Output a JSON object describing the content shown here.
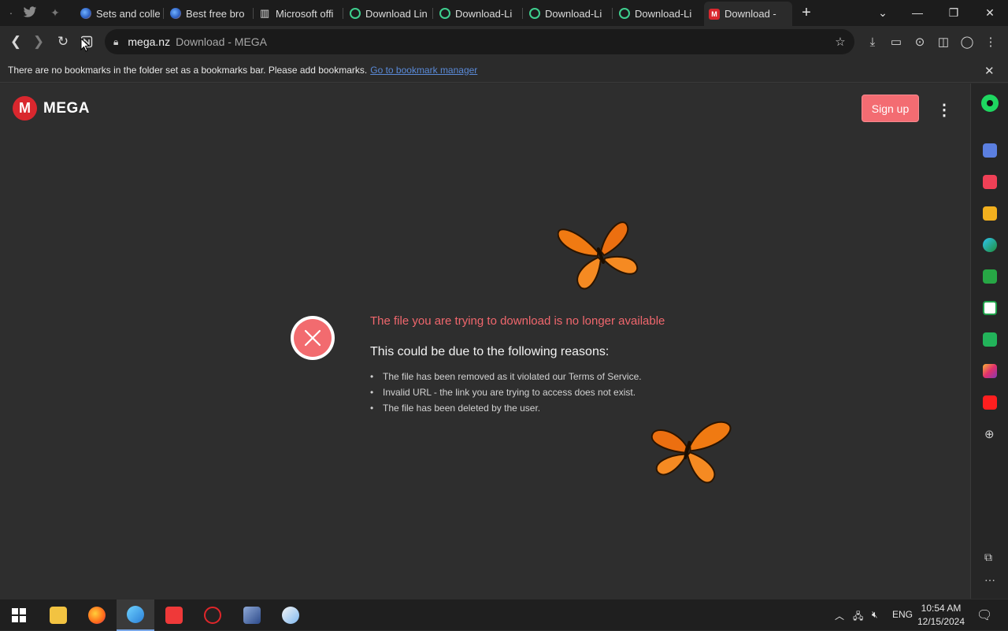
{
  "tabs": [
    {
      "label": "Sets and colle"
    },
    {
      "label": "Best free bro"
    },
    {
      "label": "Microsoft offi"
    },
    {
      "label": "Download Lin"
    },
    {
      "label": "Download-Li"
    },
    {
      "label": "Download-Li"
    },
    {
      "label": "Download-Li"
    },
    {
      "label": "Download - "
    }
  ],
  "address": {
    "host": "mega.nz",
    "page_title": "Download - MEGA"
  },
  "bookmarks_bar": {
    "message": "There are no bookmarks in the folder set as a bookmarks bar. Please add bookmarks.",
    "link": "Go to bookmark manager"
  },
  "mega": {
    "logo_text": "MEGA",
    "logo_letter": "M",
    "signup_label": "Sign up"
  },
  "error": {
    "title": "The file you are trying to download is no longer available",
    "reasons_heading": "This could be due to the following reasons:",
    "reasons": [
      "The file has been removed as it violated our Terms of Service.",
      "Invalid URL - the link you are trying to access does not exist.",
      "The file has been deleted by the user."
    ]
  },
  "taskbar": {
    "language": "ENG",
    "time": "10:54 AM",
    "date": "12/15/2024"
  },
  "colors": {
    "accent_red": "#d9272e",
    "error_text": "#f0676d",
    "signup_bg": "#f36c72"
  }
}
